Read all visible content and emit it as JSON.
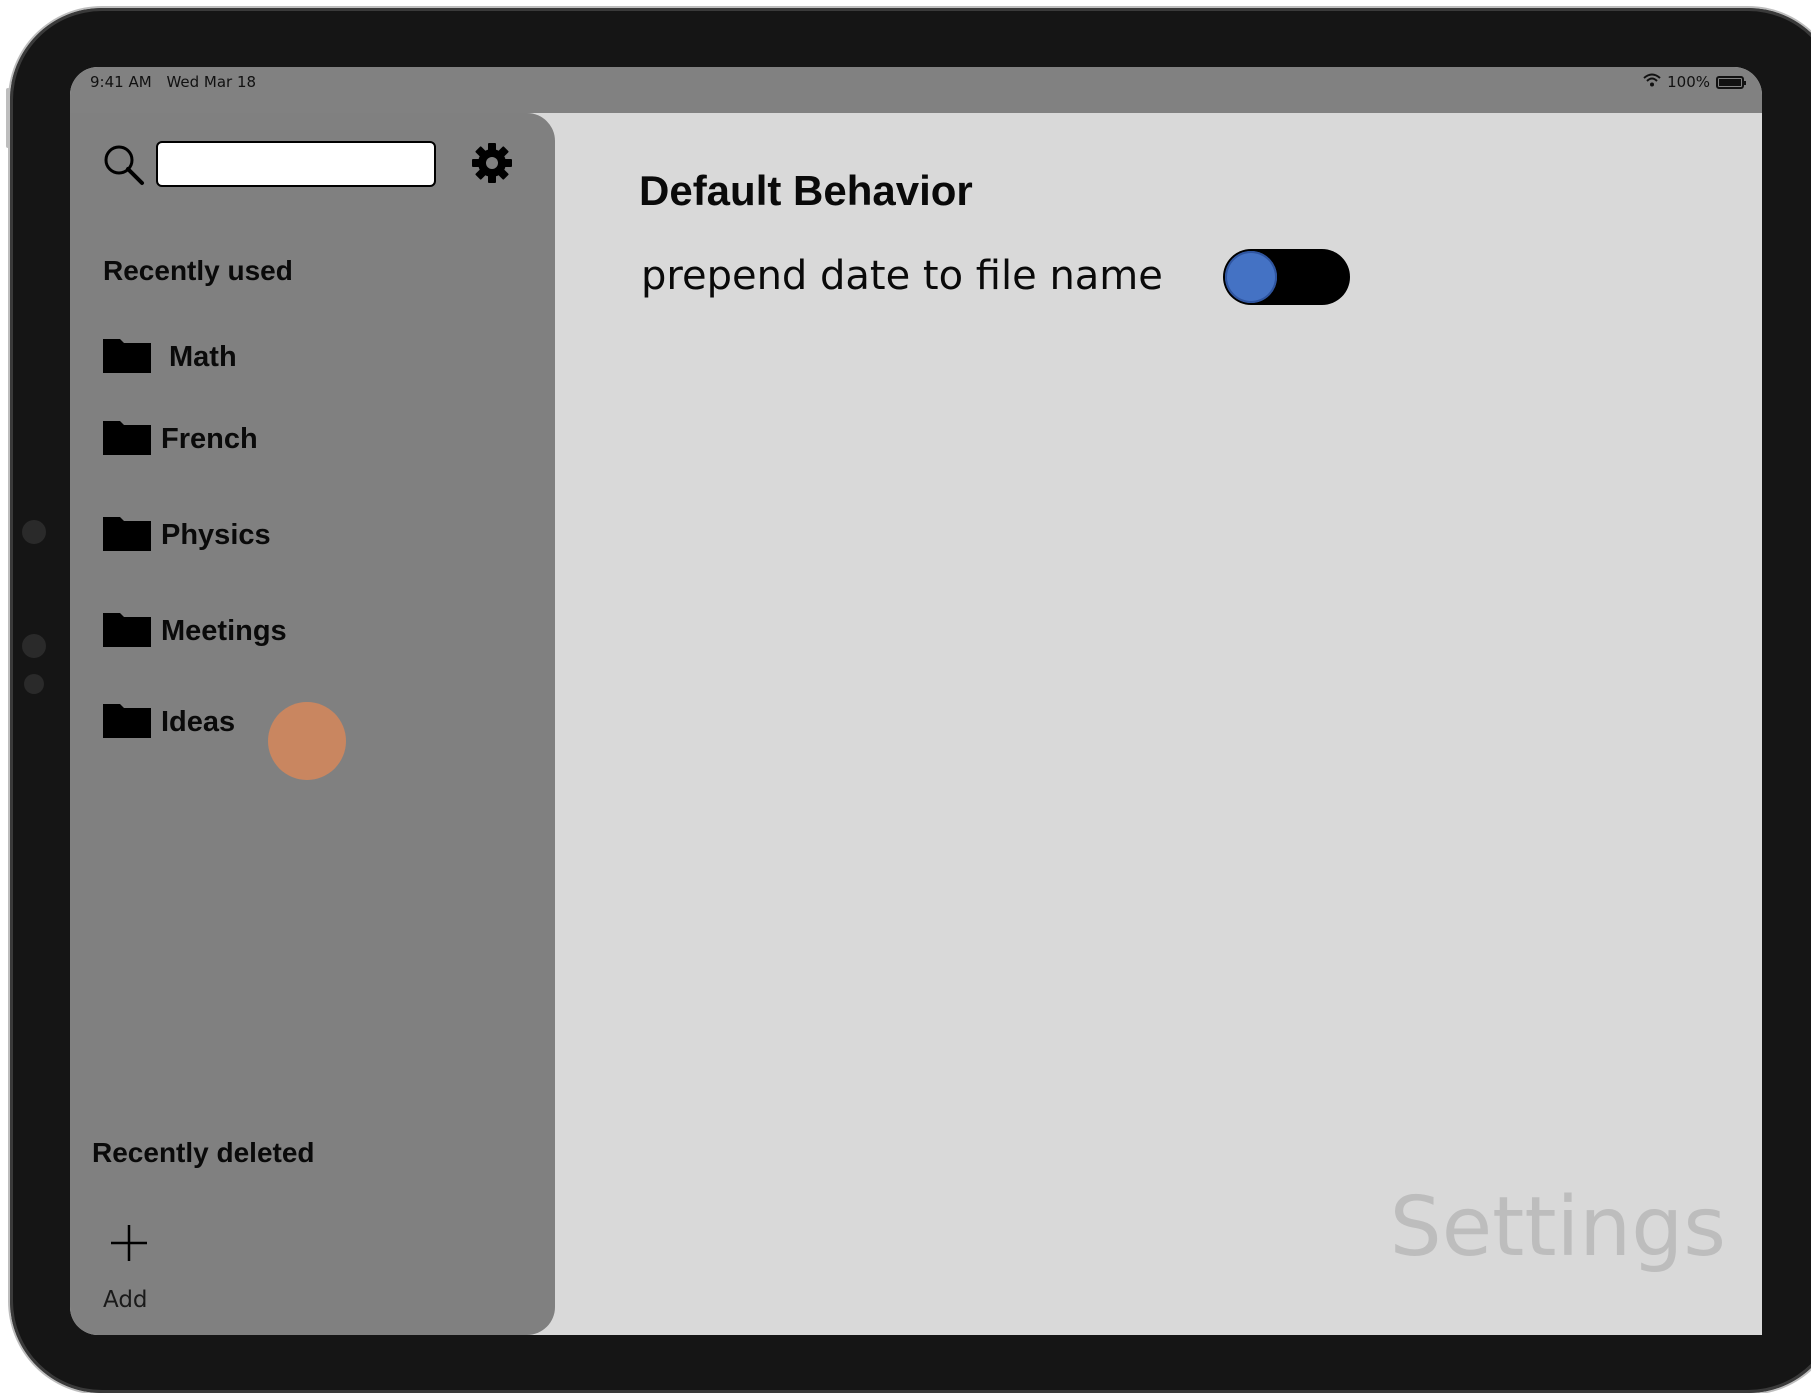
{
  "status_bar": {
    "time": "9:41 AM",
    "date": "Wed Mar 18",
    "battery": "100%",
    "wifi_icon": "wifi-icon",
    "battery_icon": "battery-icon"
  },
  "sidebar": {
    "search": {
      "placeholder": "",
      "value": ""
    },
    "recently_used_label": "Recently used",
    "folders": [
      {
        "label": "Math"
      },
      {
        "label": "French"
      },
      {
        "label": "Physics"
      },
      {
        "label": "Meetings"
      },
      {
        "label": "Ideas"
      }
    ],
    "recently_deleted_label": "Recently deleted",
    "add_label": "Add"
  },
  "main": {
    "section_title": "Default Behavior",
    "setting_label": "prepend date to file name",
    "toggle_on": false,
    "watermark": "Settings"
  },
  "colors": {
    "sidebar_bg": "#808080",
    "main_bg": "#d9d9d9",
    "toggle_track": "#000000",
    "toggle_knob": "#4472c4",
    "touch_indicator": "#d6875a"
  }
}
